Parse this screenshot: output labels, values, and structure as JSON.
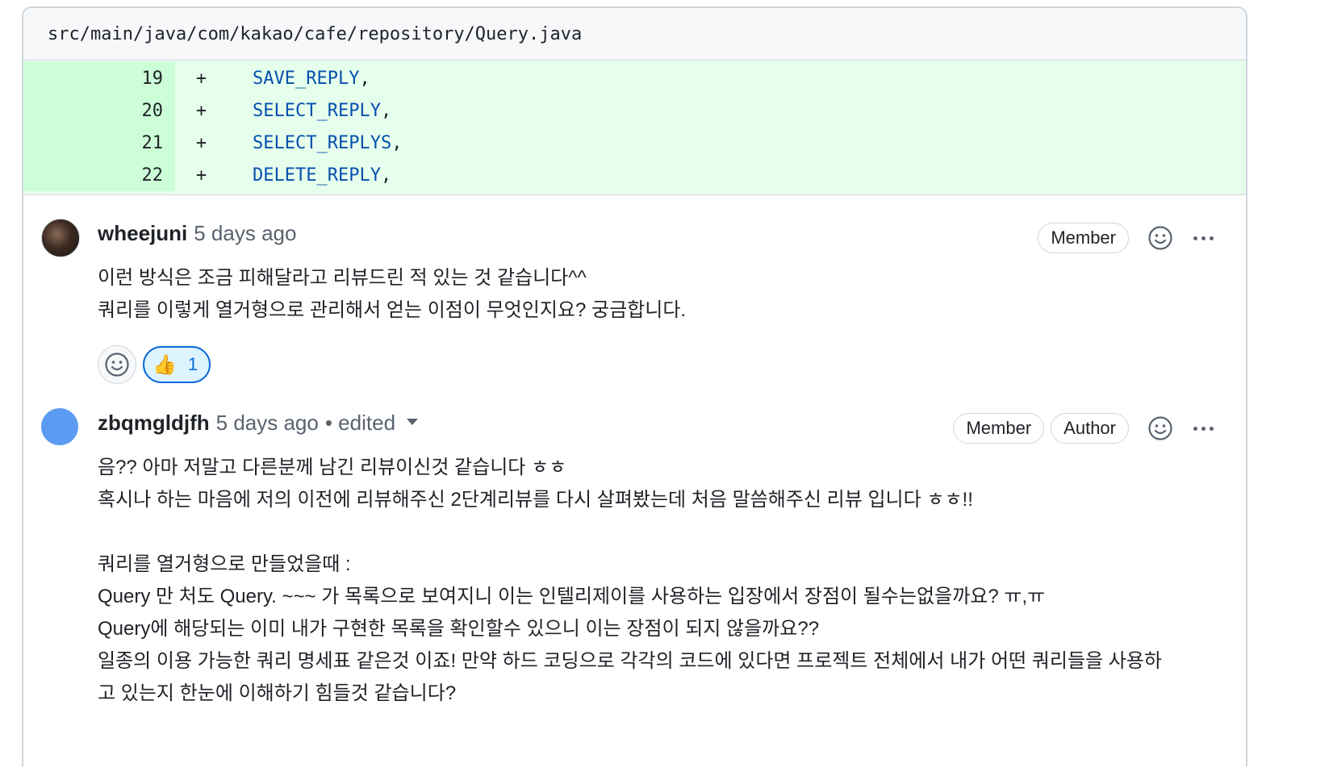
{
  "file": {
    "path": "src/main/java/com/kakao/cafe/repository/Query.java"
  },
  "diff": {
    "lines": [
      {
        "number": "19",
        "marker": "+",
        "code": "SAVE_REPLY",
        "punct": ","
      },
      {
        "number": "20",
        "marker": "+",
        "code": "SELECT_REPLY",
        "punct": ","
      },
      {
        "number": "21",
        "marker": "+",
        "code": "SELECT_REPLYS",
        "punct": ","
      },
      {
        "number": "22",
        "marker": "+",
        "code": "DELETE_REPLY",
        "punct": ","
      }
    ]
  },
  "comments": [
    {
      "author": "wheejuni",
      "time": "5 days ago",
      "badges": [
        "Member"
      ],
      "body": "이런 방식은 조금 피해달라고 리뷰드린 적 있는 것 같습니다^^\n쿼리를 이렇게 열거형으로 관리해서 얻는 이점이 무엇인지요? 궁금합니다.",
      "reaction": {
        "emoji": "👍",
        "count": "1"
      }
    },
    {
      "author": "zbqmgldjfh",
      "time": "5 days ago",
      "edited": "• edited",
      "badges": [
        "Member",
        "Author"
      ],
      "body": "음?? 아마 저말고 다른분께 남긴 리뷰이신것 같습니다 ㅎㅎ\n혹시나 하는 마음에 저의 이전에 리뷰해주신 2단계리뷰를 다시 살펴봤는데 처음 말씀해주신 리뷰 입니다 ㅎㅎ!!\n\n쿼리를 열거형으로 만들었을때 :\nQuery 만 처도 Query. ~~~ 가 목록으로 보여지니 이는 인텔리제이를 사용하는 입장에서 장점이 될수는없을까요? ㅠ,ㅠ\nQuery에 해당되는 이미 내가 구현한 목록을 확인할수 있으니 이는 장점이 되지 않을까요??\n일종의 이용 가능한 쿼리 명세표 같은것 이죠! 만약 하드 코딩으로 각각의 코드에 있다면 프로젝트 전체에서 내가 어떤 쿼리들을 사용하\n고 있는지 한눈에 이해하기 힘들것 같습니다?"
    }
  ],
  "icons": {
    "smiley": "smiley-icon",
    "more": "kebab-horizontal-icon",
    "caret": "triangle-down-icon"
  },
  "colors": {
    "diff_added_bg": "#e6ffec",
    "diff_added_gutter": "#ccffd8",
    "accent": "#0969da",
    "avatar_blue": "#5b9cf2"
  }
}
